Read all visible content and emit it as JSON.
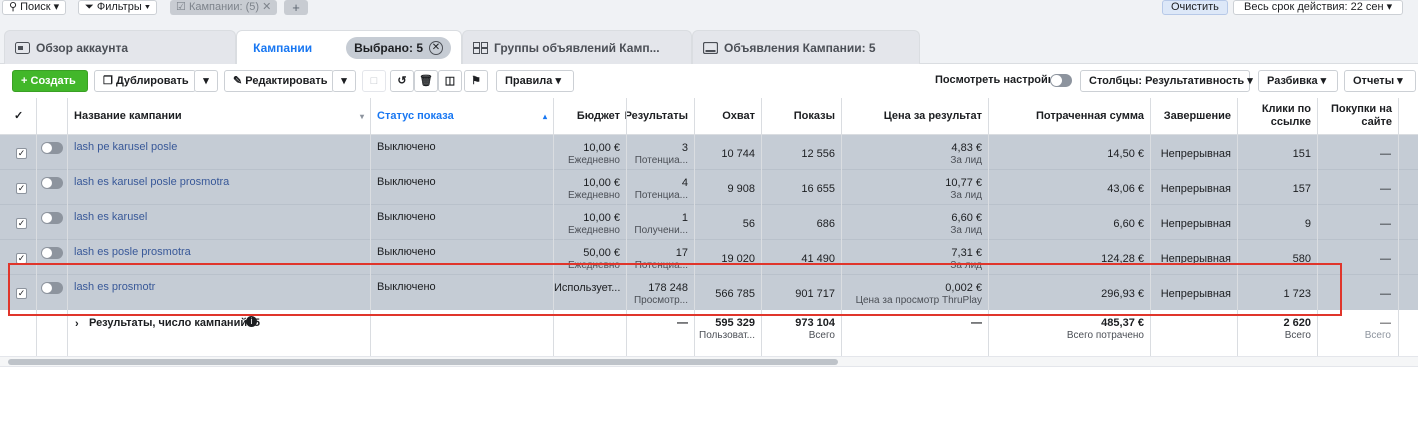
{
  "topbar": {
    "search": "Поиск",
    "filters": "Фильтры",
    "chip": "Кампании:",
    "chip_count": "(5)",
    "add": "+",
    "clear": "Очистить",
    "date_range": "Весь срок действия: 22 сен"
  },
  "tabs": [
    {
      "label": "Обзор аккаунта",
      "icon": "overview-icon"
    },
    {
      "label": "Кампании",
      "icon": "campaign-icon",
      "active": true,
      "selected": "Выбрано: 5"
    },
    {
      "label": "Группы объявлений Камп...",
      "icon": "adsets-icon"
    },
    {
      "label": "Объявления Кампании: 5",
      "icon": "ads-icon"
    }
  ],
  "toolbar": {
    "create": "Создать",
    "duplicate": "Дублировать",
    "edit": "Редактировать",
    "rules": "Правила",
    "view_settings": "Посмотреть настройки",
    "columns": "Столбцы: Результативность",
    "breakdown": "Разбивка",
    "reports": "Отчеты"
  },
  "columns": {
    "name": "Название кампании",
    "status": "Статус показа",
    "budget": "Бюджет",
    "results": "Результаты",
    "reach": "Охват",
    "impressions": "Показы",
    "cost": "Цена за результат",
    "spent": "Потраченная сумма",
    "end": "Завершение",
    "clicks": "Клики по ссылке",
    "purchases": "Покупки на сайте"
  },
  "rows": [
    {
      "name": "lash pe karusel posle",
      "status": "Выключено",
      "budget": "10,00 €",
      "budget_sub": "Ежедневно",
      "results": "3",
      "results_sub": "Потенциа...",
      "reach": "10 744",
      "impressions": "12 556",
      "cost": "4,83 €",
      "cost_sub": "За лид",
      "spent": "14,50 €",
      "end": "Непрерывная",
      "clicks": "151",
      "purchases": "—"
    },
    {
      "name": "lash es karusel posle prosmotra",
      "status": "Выключено",
      "budget": "10,00 €",
      "budget_sub": "Ежедневно",
      "results": "4",
      "results_sub": "Потенциа...",
      "reach": "9 908",
      "impressions": "16 655",
      "cost": "10,77 €",
      "cost_sub": "За лид",
      "spent": "43,06 €",
      "end": "Непрерывная",
      "clicks": "157",
      "purchases": "—"
    },
    {
      "name": "lash es karusel",
      "status": "Выключено",
      "budget": "10,00 €",
      "budget_sub": "Ежедневно",
      "results": "1",
      "results_sub": "Получени...",
      "reach": "56",
      "impressions": "686",
      "cost": "6,60 €",
      "cost_sub": "За лид",
      "spent": "6,60 €",
      "end": "Непрерывная",
      "clicks": "9",
      "purchases": "—"
    },
    {
      "name": "lash es posle prosmotra",
      "status": "Выключено",
      "budget": "50,00 €",
      "budget_sub": "Ежедневно",
      "results": "17",
      "results_sub": "Потенциа...",
      "reach": "19 020",
      "impressions": "41 490",
      "cost": "7,31 €",
      "cost_sub": "За лид",
      "spent": "124,28 €",
      "end": "Непрерывная",
      "clicks": "580",
      "purchases": "—"
    },
    {
      "name": "lash es prosmotr",
      "status": "Выключено",
      "budget": "Использует...",
      "budget_sub": "",
      "results": "178 248",
      "results_sub": "Просмотр...",
      "reach": "566 785",
      "impressions": "901 717",
      "cost": "0,002 €",
      "cost_sub": "Цена за просмотр ThruPlay",
      "spent": "296,93 €",
      "end": "Непрерывная",
      "clicks": "1 723",
      "purchases": "—"
    }
  ],
  "totals": {
    "label": "Результаты, число кампаний: 5",
    "results": "—",
    "reach": "595 329",
    "reach_sub": "Пользоват...",
    "impressions": "973 104",
    "impressions_sub": "Всего",
    "cost": "—",
    "spent": "485,37 €",
    "spent_sub": "Всего потрачено",
    "clicks": "2 620",
    "clicks_sub": "Всего",
    "purchases": "—",
    "purchases_sub": "Всего"
  },
  "colors": {
    "accent": "#1877f2",
    "create": "#42b72a",
    "row_selected": "#c5ccd5",
    "highlight": "#e0352b"
  }
}
